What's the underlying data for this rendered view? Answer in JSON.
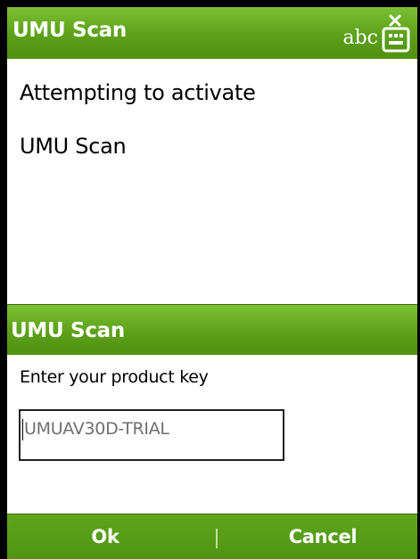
{
  "app": {
    "title": "UMU Scan",
    "input_mode": "abc",
    "input_icon": "keyboard-icon"
  },
  "message": {
    "line1": "Attempting to activate",
    "line2": "UMU Scan"
  },
  "dialog": {
    "title": "UMU Scan",
    "prompt": "Enter your product key",
    "product_key_value": "UMUAV30D-TRIAL"
  },
  "softkeys": {
    "left_label": "Ok",
    "right_label": "Cancel"
  },
  "colors": {
    "accent": "#5ea31a",
    "background": "#ffffff",
    "text": "#000000",
    "input_text": "#6f6f6f"
  }
}
